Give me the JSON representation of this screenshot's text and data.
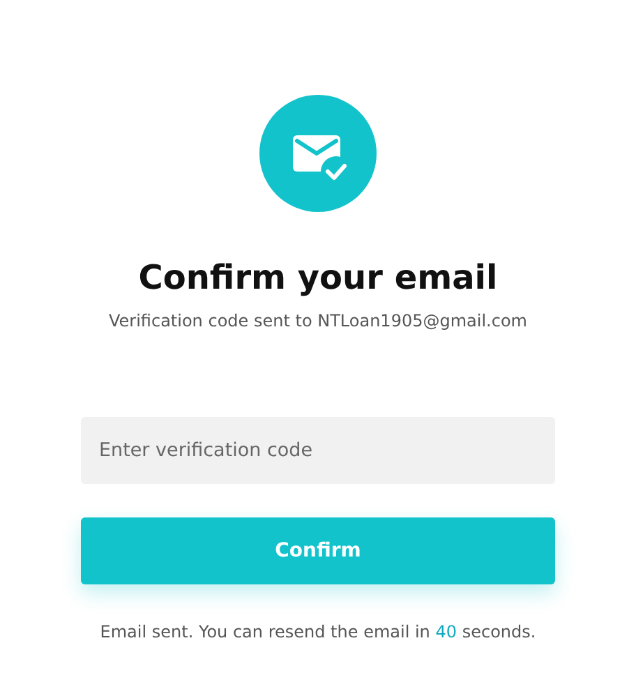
{
  "title": "Confirm your email",
  "subtitle": "Verification code sent to NTLoan1905@gmail.com",
  "code_field": {
    "placeholder": "Enter verification code"
  },
  "confirm_button": "Confirm",
  "resend_note": {
    "before": "Email sent. You can resend the email in ",
    "countdown": "40",
    "after": " seconds."
  }
}
